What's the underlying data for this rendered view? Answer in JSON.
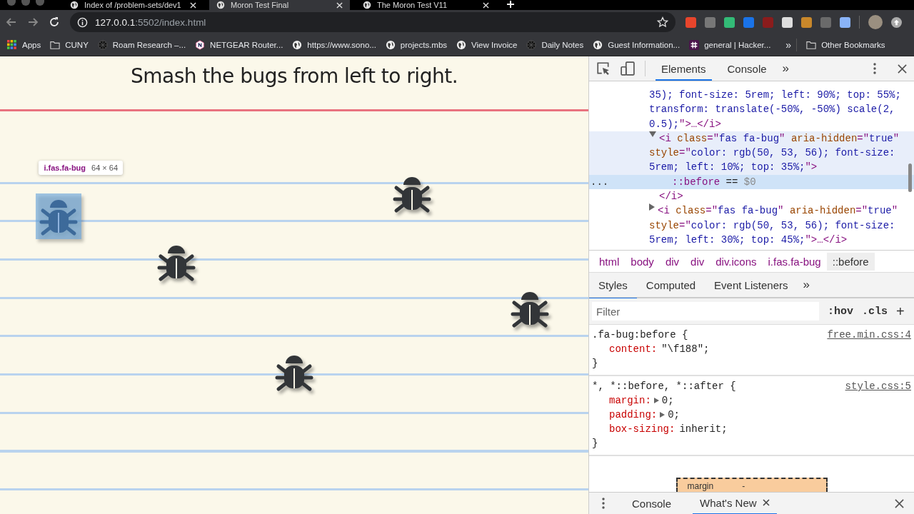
{
  "browser": {
    "tabs": [
      {
        "title": "Index of /problem-sets/dev1",
        "selected": false
      },
      {
        "title": "Moron Test Final",
        "selected": true
      },
      {
        "title": "The Moron Test V11",
        "selected": false
      }
    ],
    "url": {
      "host": "127.0.0.1",
      "path": ":5502/index.html"
    },
    "bookmarks": [
      {
        "label": "Apps",
        "kind": "grid"
      },
      {
        "label": "CUNY",
        "kind": "folder"
      },
      {
        "label": "Roam Research –...",
        "kind": "wheel"
      },
      {
        "label": "NETGEAR Router...",
        "kind": "hexagon"
      },
      {
        "label": "https://www.sono...",
        "kind": "globe"
      },
      {
        "label": "projects.mbs",
        "kind": "globe"
      },
      {
        "label": "View Invoice",
        "kind": "globe"
      },
      {
        "label": "Daily Notes",
        "kind": "wheel"
      },
      {
        "label": "Guest Information...",
        "kind": "globe"
      },
      {
        "label": "general | Hacker...",
        "kind": "hash"
      }
    ],
    "more_bookmarks": "»",
    "other_bookmarks": "Other Bookmarks"
  },
  "page": {
    "heading": "Smash the bugs from left to right.",
    "bugs": [
      {
        "highlighted": true
      },
      {
        "highlighted": false
      },
      {
        "highlighted": false
      },
      {
        "highlighted": false
      },
      {
        "highlighted": false
      }
    ],
    "tooltip": {
      "selector": "i.fas.fa-bug",
      "size": "64 × 64"
    }
  },
  "devtools": {
    "tabs": [
      {
        "label": "Elements",
        "selected": true
      },
      {
        "label": "Console",
        "selected": false
      }
    ],
    "more": "»",
    "dom_lines": [
      {
        "kind": "text",
        "hovered": false,
        "selected": false,
        "tokens": [
          {
            "kind": "val",
            "t": "35); font-size: 5rem; left: 90%; top: 55%;"
          }
        ]
      },
      {
        "kind": "text",
        "hovered": false,
        "selected": false,
        "tokens": [
          {
            "kind": "val",
            "t": "transform: translate(-50%, -50%) scale(2,"
          }
        ]
      },
      {
        "kind": "text",
        "hovered": false,
        "selected": false,
        "tokens": [
          {
            "kind": "val",
            "t": "0.5);"
          },
          {
            "kind": "tag",
            "t": "\">…</i>"
          }
        ]
      },
      {
        "kind": "element",
        "expanded": true,
        "hovered": true,
        "selected": false,
        "tokens": [
          {
            "kind": "tag",
            "t": "<i "
          },
          {
            "kind": "attr",
            "t": "class"
          },
          {
            "kind": "tag",
            "t": "=\""
          },
          {
            "kind": "val",
            "t": "fas fa-bug"
          },
          {
            "kind": "tag",
            "t": "\" "
          },
          {
            "kind": "attr",
            "t": "aria-hidden"
          },
          {
            "kind": "tag",
            "t": "=\""
          },
          {
            "kind": "val",
            "t": "true"
          },
          {
            "kind": "tag",
            "t": "\""
          }
        ]
      },
      {
        "kind": "text",
        "hovered": true,
        "selected": false,
        "tokens": [
          {
            "kind": "attr",
            "t": "style"
          },
          {
            "kind": "tag",
            "t": "=\""
          },
          {
            "kind": "val",
            "t": "color: rgb(50, 53, 56); font-size:"
          }
        ]
      },
      {
        "kind": "text",
        "hovered": true,
        "selected": false,
        "tokens": [
          {
            "kind": "val",
            "t": "5rem; left: 10%; top: 35%;"
          },
          {
            "kind": "tag",
            "t": "\">"
          }
        ]
      },
      {
        "kind": "pseudo",
        "hovered": false,
        "selected": true,
        "tokens": [
          {
            "kind": "tag",
            "t": "::before"
          },
          {
            "kind": "plain",
            "t": " == "
          },
          {
            "kind": "dim",
            "t": "$0"
          }
        ]
      },
      {
        "kind": "close",
        "hovered": false,
        "selected": false,
        "tokens": [
          {
            "kind": "tag",
            "t": "</i>"
          }
        ]
      },
      {
        "kind": "element",
        "expanded": false,
        "hovered": false,
        "selected": false,
        "tokens": [
          {
            "kind": "tag",
            "t": "<i "
          },
          {
            "kind": "attr",
            "t": "class"
          },
          {
            "kind": "tag",
            "t": "=\""
          },
          {
            "kind": "val",
            "t": "fas fa-bug"
          },
          {
            "kind": "tag",
            "t": "\" "
          },
          {
            "kind": "attr",
            "t": "aria-hidden"
          },
          {
            "kind": "tag",
            "t": "=\""
          },
          {
            "kind": "val",
            "t": "true"
          },
          {
            "kind": "tag",
            "t": "\""
          }
        ]
      },
      {
        "kind": "text",
        "hovered": false,
        "selected": false,
        "tokens": [
          {
            "kind": "attr",
            "t": "style"
          },
          {
            "kind": "tag",
            "t": "=\""
          },
          {
            "kind": "val",
            "t": "color: rgb(50, 53, 56); font-size:"
          }
        ]
      },
      {
        "kind": "text",
        "hovered": false,
        "selected": false,
        "tokens": [
          {
            "kind": "val",
            "t": "5rem; left: 30%; top: 45%;"
          },
          {
            "kind": "tag",
            "t": "\">…</i>"
          }
        ]
      }
    ],
    "selected_marker": "...",
    "breadcrumbs": [
      {
        "label": "html",
        "selected": false
      },
      {
        "label": "body",
        "selected": false
      },
      {
        "label": "div",
        "selected": false
      },
      {
        "label": "div",
        "selected": false
      },
      {
        "label": "div.icons",
        "selected": false
      },
      {
        "label": "i.fas.fa-bug",
        "selected": false
      },
      {
        "label": "::before",
        "selected": true
      }
    ],
    "styles_tabs": [
      {
        "label": "Styles",
        "selected": true
      },
      {
        "label": "Computed",
        "selected": false
      },
      {
        "label": "Event Listeners",
        "selected": false
      }
    ],
    "styles_more": "»",
    "filter": {
      "placeholder": "Filter"
    },
    "hov": ":hov",
    "cls": ".cls",
    "add": "+",
    "rules": [
      {
        "selector": ".fa-bug:before {",
        "source": "free.min.css:4",
        "decls": [
          {
            "prop": "content:",
            "value": "\"\\f188\";",
            "expandable": false
          }
        ],
        "close": "}"
      },
      {
        "selector": "*, *::before, *::after {",
        "source": "style.css:5",
        "decls": [
          {
            "prop": "margin:",
            "value": "0;",
            "expandable": true
          },
          {
            "prop": "padding:",
            "value": "0;",
            "expandable": true
          },
          {
            "prop": "box-sizing:",
            "value": "inherit;",
            "expandable": false
          }
        ],
        "close": "}"
      }
    ],
    "box_model": {
      "label": "margin",
      "value": "-"
    },
    "drawer_tabs": [
      {
        "label": "Console",
        "selected": false,
        "closable": false
      },
      {
        "label": "What's New",
        "selected": true,
        "closable": true
      }
    ]
  }
}
